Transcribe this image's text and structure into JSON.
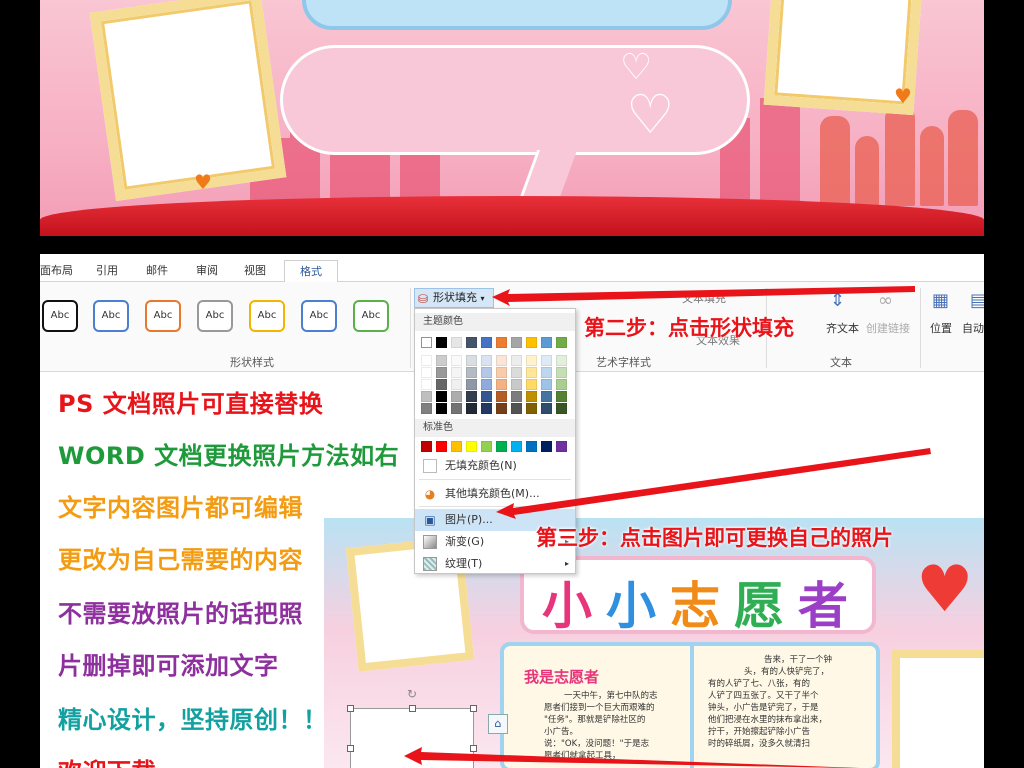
{
  "tabs": [
    {
      "label": "面布局"
    },
    {
      "label": "引用"
    },
    {
      "label": "邮件"
    },
    {
      "label": "审阅"
    },
    {
      "label": "视图"
    },
    {
      "label": "格式"
    }
  ],
  "ribbon": {
    "shape_style_swatch": "Abc",
    "shape_styles_label": "形状样式",
    "shape_fill_label": "形状填充",
    "text_fill_label": "文本填充",
    "text_effects_label": "文本效果",
    "wordart_label": "艺术字样式",
    "align_text_label": "齐文本",
    "create_link_label": "创建链接",
    "text_group_label": "文本",
    "position_label": "位置",
    "auto_wrap_label": "自动"
  },
  "dropdown": {
    "theme_colors_label": "主题颜色",
    "standard_colors_label": "标准色",
    "no_fill_label": "无填充颜色(N)",
    "more_colors_label": "其他填充颜色(M)...",
    "picture_label": "图片(P)...",
    "gradient_label": "渐变(G)",
    "texture_label": "纹理(T)",
    "theme_top_row": [
      "#ffffff",
      "#000000",
      "#e7e6e6",
      "#44546a",
      "#4472c4",
      "#ed7d31",
      "#a5a5a5",
      "#ffc000",
      "#5b9bd5",
      "#70ad47"
    ],
    "standard_row": [
      "#c00000",
      "#ff0000",
      "#ffc000",
      "#ffff00",
      "#92d050",
      "#00b050",
      "#00b0f0",
      "#0070c0",
      "#002060",
      "#7030a0"
    ]
  },
  "instructions": [
    {
      "text": "PS 文档照片可直接替换",
      "color": "#e8141a"
    },
    {
      "text": "WORD 文档更换照片方法如右",
      "color": "#1e9a3a"
    },
    {
      "text": "文字内容图片都可编辑",
      "color": "#f39c12"
    },
    {
      "text": "更改为自己需要的内容",
      "color": "#f39c12"
    },
    {
      "text": "不需要放照片的话把照",
      "color": "#8e2f9e"
    },
    {
      "text": "片删掉即可添加文字",
      "color": "#8e2f9e"
    },
    {
      "text": "精心设计，坚持原创！！",
      "color": "#12a0a0"
    },
    {
      "text": "欢迎下载~",
      "color": "#e8141a"
    }
  ],
  "steps": {
    "step2": "第二步：点击形状填充",
    "step3": "第三步：点击图片即可更换自己的照片"
  },
  "poster": {
    "title_chars": [
      {
        "ch": "小",
        "color": "#e8347a"
      },
      {
        "ch": "小",
        "color": "#2f8fe0"
      },
      {
        "ch": "志",
        "color": "#f08a18"
      },
      {
        "ch": "愿",
        "color": "#2fae54"
      },
      {
        "ch": "者",
        "color": "#9b3fc7"
      }
    ],
    "heading": "我是志愿者",
    "left_lines": [
      "一天中午，第七中队的志",
      "愿者们接到一个巨大而艰难的",
      "\"任务\"。那就是铲除社区的",
      "小广告。",
      "说：\"OK，没问题！\"于是志",
      "愿者们就拿起工具，"
    ],
    "right_lines": [
      "告来，干了一个钟",
      "头，有的人快铲完了，",
      "有的人铲了七、八张，有的",
      "人铲了四五张了。又干了半个",
      "钟头，小广告是铲完了，于是",
      "他们把浸在水里的抹布拿出来，",
      "拧干，开始擦起铲除小广告",
      "时的碎纸屑，没多久就清扫"
    ]
  }
}
